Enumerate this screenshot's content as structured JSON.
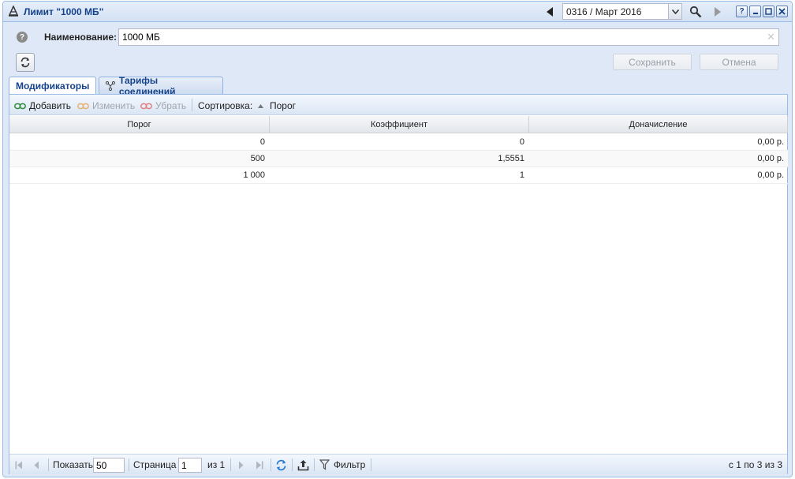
{
  "window": {
    "title": "Лимит \"1000 МБ\"",
    "period": "0316 / Март 2016",
    "help_label": "?"
  },
  "form": {
    "name_label": "Наименование:",
    "name_value": "1000 МБ",
    "save_label": "Сохранить",
    "cancel_label": "Отмена"
  },
  "tabs": [
    {
      "label": "Модификаторы",
      "active": true
    },
    {
      "label": "Тарифы соединений",
      "active": false
    }
  ],
  "toolbar": {
    "add_label": "Добавить",
    "edit_label": "Изменить",
    "delete_label": "Убрать",
    "sort_label": "Сортировка:",
    "sort_field": "Порог"
  },
  "grid": {
    "columns": [
      "Порог",
      "Коэффициент",
      "Доначисление"
    ],
    "rows": [
      [
        "0",
        "0",
        "0,00 р."
      ],
      [
        "500",
        "1,5551",
        "0,00 р."
      ],
      [
        "1 000",
        "1",
        "0,00 р."
      ]
    ]
  },
  "pager": {
    "show_label": "Показать",
    "page_size": "50",
    "page_label": "Страница",
    "page_value": "1",
    "of_label": "из 1",
    "filter_label": "Фильтр",
    "summary": "с 1 по 3 из 3"
  },
  "colors": {
    "title_text": "#15428b",
    "frame_border": "#99bbe8",
    "frame_bg": "#dfe8f6"
  }
}
